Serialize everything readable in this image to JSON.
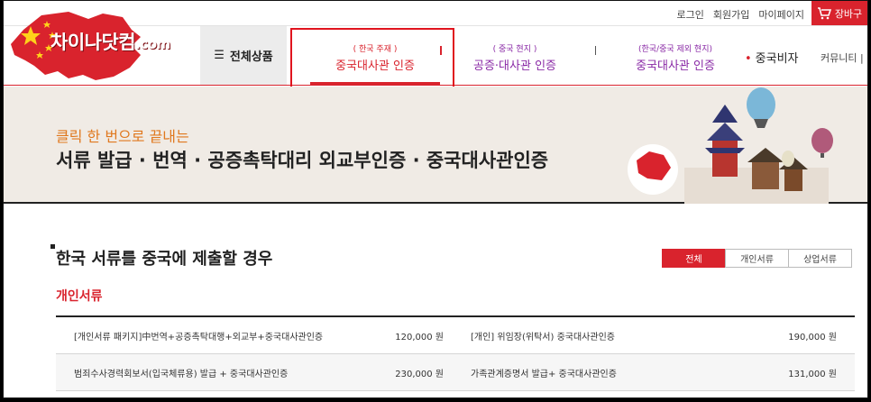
{
  "util": {
    "login": "로그인",
    "signup": "회원가입",
    "mypage": "마이페이지",
    "cart": "장바구"
  },
  "logo": {
    "text": "차이나닷컴",
    "suffix": ".com"
  },
  "nav": {
    "all_menu": "전체상품",
    "items": [
      {
        "sub": "( 한국 주재 )",
        "label": "중국대사관 인증"
      },
      {
        "sub": "( 중국 현지 )",
        "label": "공증·대사관 인증"
      },
      {
        "sub": "(한국/중국 제외 현지)",
        "label": "중국대사관 인증"
      }
    ],
    "visa": "중국비자",
    "community": "커뮤니티 | 건"
  },
  "banner": {
    "subtitle": "클릭 한 번으로 끝내는",
    "title": "서류 발급 · 번역 · 공증촉탁대리 외교부인증 · 중국대사관인증"
  },
  "section": {
    "title": "한국 서류를 중국에 제출할 경우",
    "category": "개인서류",
    "tabs": [
      "전체",
      "개인서류",
      "상업서류"
    ]
  },
  "table": {
    "rows": [
      {
        "name": "[개인서류 패키지]中번역+공증촉탁대행+외교부+중국대사관인증",
        "price": "120,000 원",
        "name2": "[개인] 위임장(위탁서) 중국대사관인증",
        "price2": "190,000 원"
      },
      {
        "name": "범죄수사경력회보서(입국체류용) 발급 + 중국대사관인증",
        "price": "230,000 원",
        "name2": "가족관계증명서 발급+ 중국대사관인증",
        "price2": "131,000 원"
      }
    ]
  },
  "colors": {
    "accent": "#d9232d",
    "purple": "#8a2aa6",
    "orange": "#e0781e"
  }
}
